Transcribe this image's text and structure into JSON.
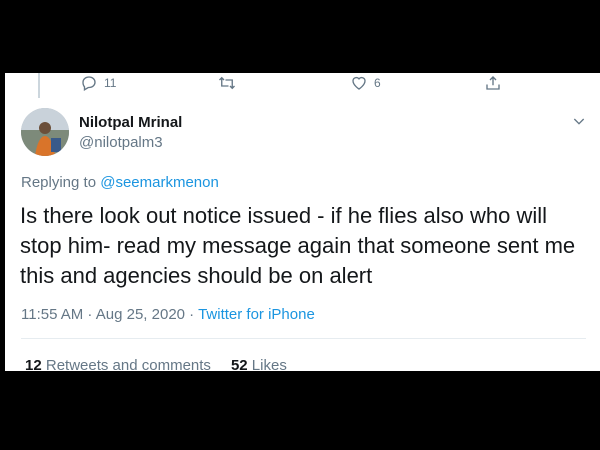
{
  "prev_tweet_actions": {
    "reply_count": "11",
    "like_count": "6"
  },
  "tweet": {
    "author_name": "Nilotpal Mrinal",
    "author_handle": "@nilotpalm3",
    "replying_prefix": "Replying to",
    "replying_to": "@seemarkmenon",
    "text": "Is there look out notice issued - if he flies also who will stop him- read my message again that someone sent me this and agencies should be on alert",
    "timestamp": "11:55 AM · Aug 25, 2020 · ",
    "source": "Twitter for iPhone",
    "retweets_count": "12",
    "retweets_label": "Retweets and comments",
    "likes_count": "52",
    "likes_label": "Likes"
  },
  "colors": {
    "text_primary": "#14171a",
    "text_secondary": "#657786",
    "link": "#1b95e0",
    "background": "#000000",
    "card": "#ffffff"
  }
}
